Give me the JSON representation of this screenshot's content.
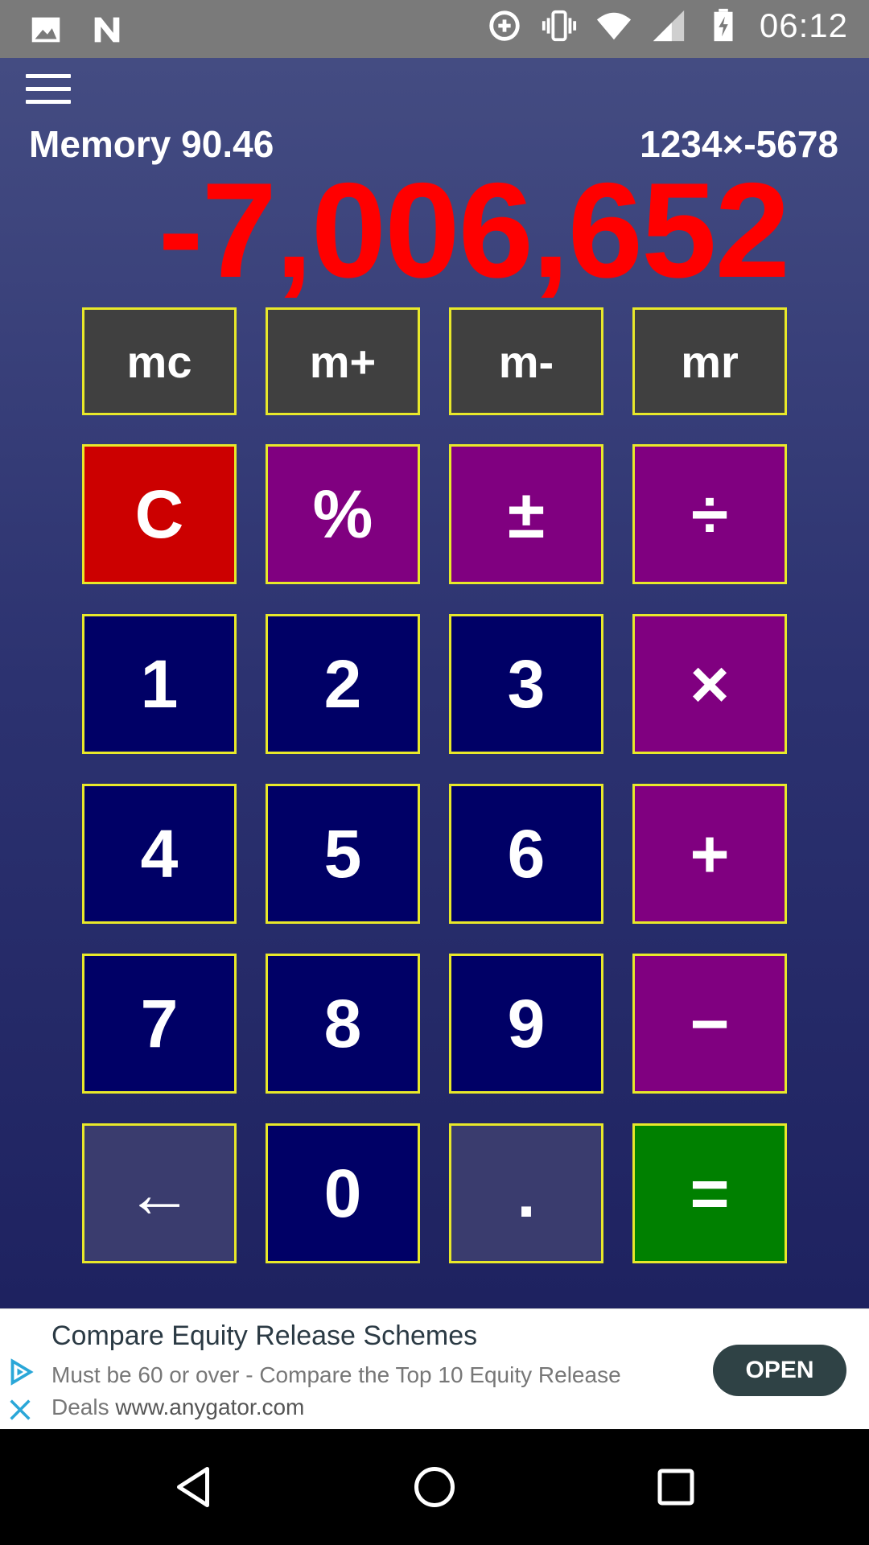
{
  "status_bar": {
    "time": "06:12",
    "icons": [
      "image-icon",
      "n-notification-icon",
      "data-saver-icon",
      "vibrate-icon",
      "wifi-icon",
      "signal-icon",
      "battery-charging-icon"
    ]
  },
  "header": {
    "memory_label": "Memory 90.46",
    "expression": "1234×-5678",
    "result": "-7,006,652",
    "result_color": "#ff0000"
  },
  "keypad": {
    "memory_row": [
      "mc",
      "m+",
      "m-",
      "mr"
    ],
    "rows": [
      [
        "C",
        "%",
        "±",
        "÷"
      ],
      [
        "1",
        "2",
        "3",
        "×"
      ],
      [
        "4",
        "5",
        "6",
        "+"
      ],
      [
        "7",
        "8",
        "9",
        "−"
      ],
      [
        "←",
        "0",
        ".",
        "="
      ]
    ],
    "colors": {
      "digit": "#000066",
      "operator": "#800080",
      "clear": "#cc0000",
      "equals": "#008000",
      "memory": "#404040",
      "border": "#e8e82a"
    }
  },
  "ad": {
    "title": "Compare Equity Release Schemes",
    "body": "Must be 60 or over - Compare the Top 10 Equity Release Deals",
    "url": "www.anygator.com",
    "button": "OPEN"
  },
  "nav_bar": {
    "buttons": [
      "back-icon",
      "home-icon",
      "recents-icon"
    ]
  }
}
